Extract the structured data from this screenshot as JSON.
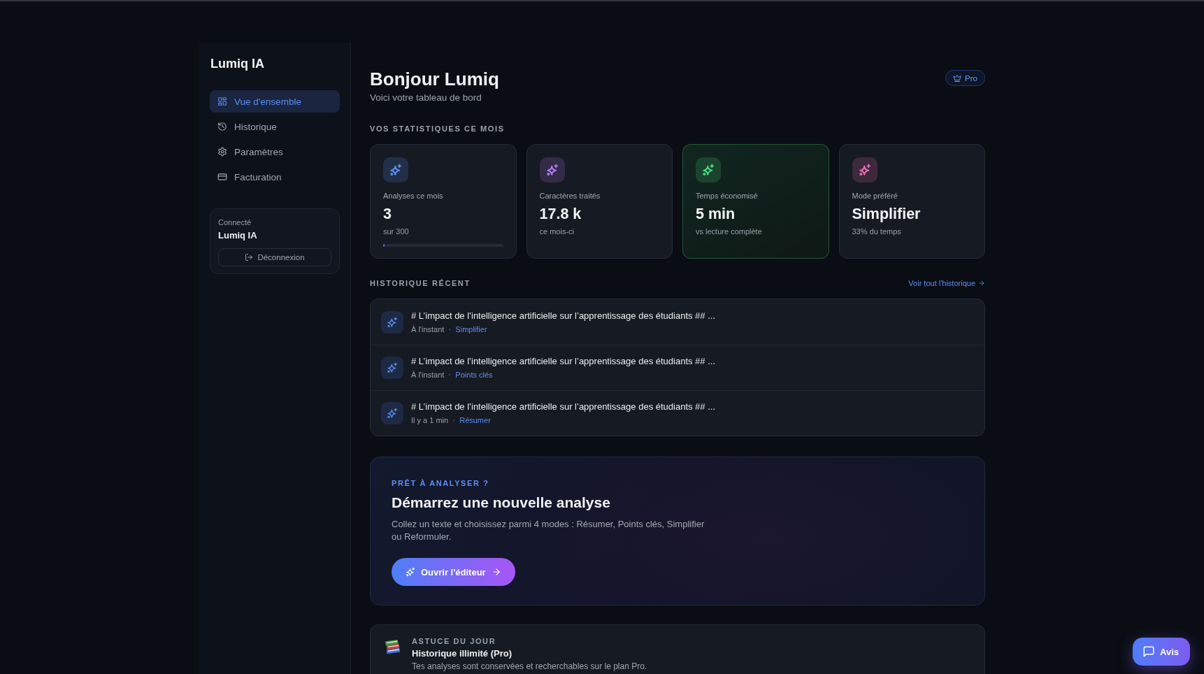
{
  "sidebar": {
    "logo": "Lumiq IA",
    "nav": [
      {
        "label": "Vue d'ensemble",
        "selected": true
      },
      {
        "label": "Historique",
        "selected": false
      },
      {
        "label": "Paramètres",
        "selected": false
      },
      {
        "label": "Facturation",
        "selected": false
      }
    ],
    "account": {
      "status": "Connecté",
      "name": "Lumiq IA",
      "logout": "Déconnexion"
    }
  },
  "header": {
    "title": "Bonjour Lumiq",
    "subtitle": "Voici votre tableau de bord",
    "badge": "Pro"
  },
  "stats": {
    "heading": "VOS STATISTIQUES CE MOIS",
    "cards": [
      {
        "label": "Analyses ce mois",
        "value": "3",
        "sub": "sur 300",
        "color": "#5b8ff7",
        "highlighted": false,
        "level": 0.01
      },
      {
        "label": "Caractères traités",
        "value": "17.8 k",
        "sub": "ce mois-ci",
        "color": "#b57cf5",
        "highlighted": false
      },
      {
        "label": "Temps économisé",
        "value": "5 min",
        "sub": "vs lecture complète",
        "color": "#4ade80",
        "highlighted": true
      },
      {
        "label": "Mode préféré",
        "value": "Simplifier",
        "sub": "33% du temps",
        "color": "#ec6fb5",
        "highlighted": false
      }
    ]
  },
  "history": {
    "heading": "HISTORIQUE RÉCENT",
    "link": "Voir tout l'historique",
    "items": [
      {
        "title": "# L’impact de l’intelligence artificielle sur l’apprentissage des étudiants ## ...",
        "time": "À l'instant",
        "mode": "Simplifier"
      },
      {
        "title": "# L’impact de l’intelligence artificielle sur l’apprentissage des étudiants ## ...",
        "time": "À l'instant",
        "mode": "Points clés"
      },
      {
        "title": "# L’impact de l’intelligence artificielle sur l’apprentissage des étudiants ## ...",
        "time": "Il y a 1 min",
        "mode": "Résumer"
      }
    ]
  },
  "cta": {
    "eyebrow": "PRÊT À ANALYSER ?",
    "title": "Démarrez une nouvelle analyse",
    "description": "Collez un texte et choisissez parmi 4 modes : Résumer, Points clés, Simplifier ou Reformuler.",
    "button": "Ouvrir l'éditeur"
  },
  "tip": {
    "eyebrow": "ASTUCE DU JOUR",
    "title": "Historique illimité (Pro)",
    "text": "Tes analyses sont conservées et recherchables sur le plan Pro."
  },
  "feedback_button": "Avis"
}
